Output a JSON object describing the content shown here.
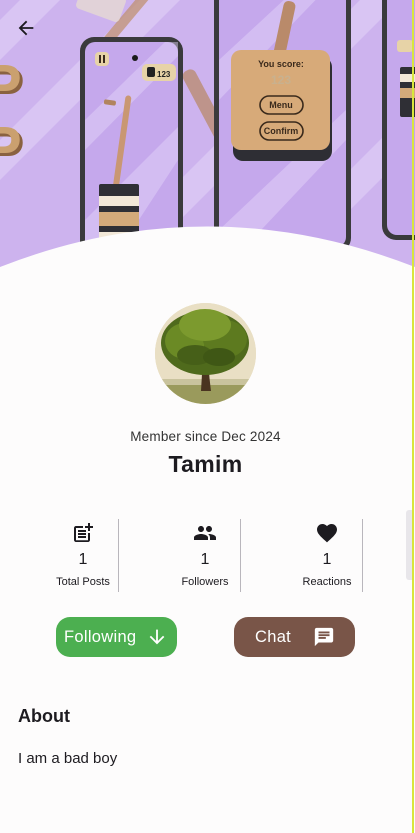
{
  "cover": {
    "game": {
      "score_label": "You score:",
      "score_value": "123",
      "menu_button": "Menu",
      "confirm_button": "Confirm",
      "hud_score": "123"
    }
  },
  "profile": {
    "member_since": "Member since Dec 2024",
    "name": "Tamim"
  },
  "stats": [
    {
      "icon": "post-add-icon",
      "count": "1",
      "label": "Total Posts"
    },
    {
      "icon": "people-icon",
      "count": "1",
      "label": "Followers"
    },
    {
      "icon": "heart-icon",
      "count": "1",
      "label": "Reactions"
    }
  ],
  "actions": {
    "following_label": "Following",
    "following_icon": "arrow-down-icon",
    "chat_label": "Chat",
    "chat_icon": "chat-icon"
  },
  "about": {
    "title": "About",
    "body": "I am a bad boy"
  },
  "colors": {
    "following_button": "#4caf50",
    "chat_button": "#795548",
    "cover_background": "#cdb3ee",
    "page_background": "#fdfcfc"
  }
}
